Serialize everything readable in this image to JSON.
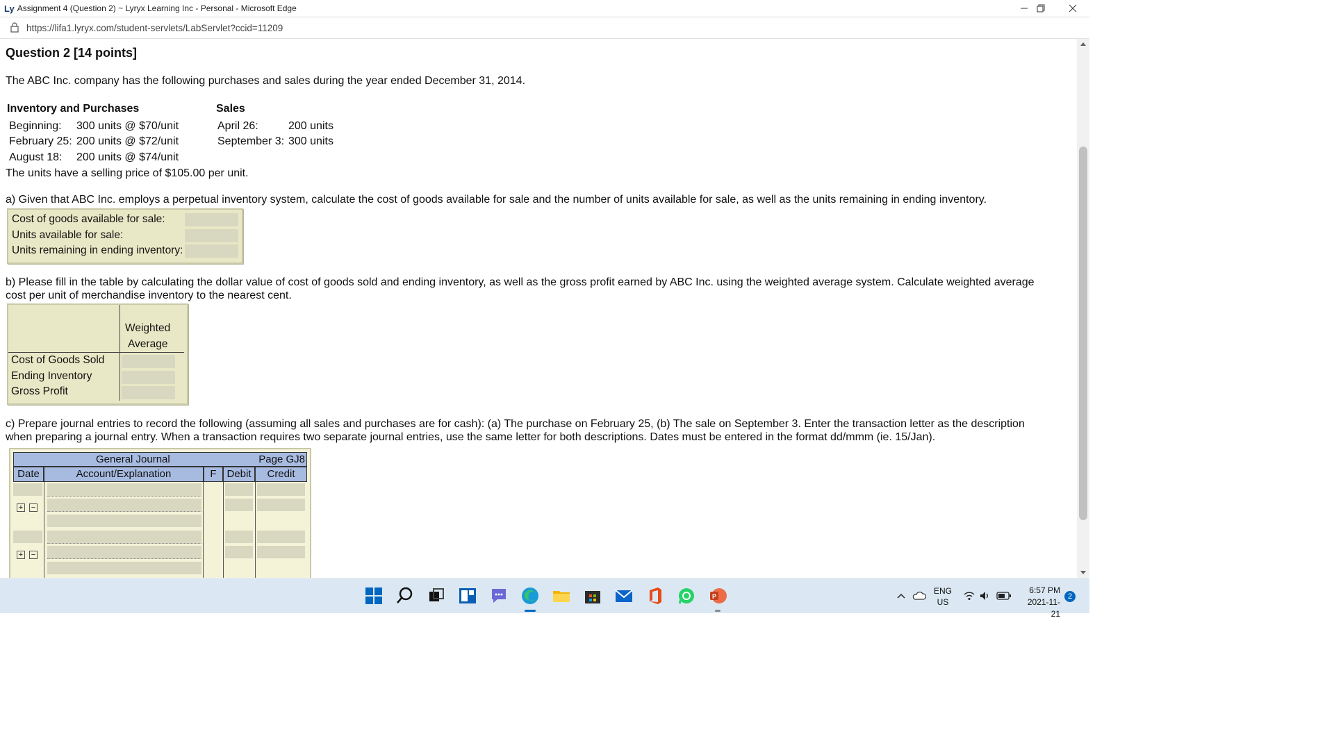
{
  "window": {
    "title": "Assignment 4 (Question 2) ~ Lyryx Learning Inc - Personal - Microsoft Edge",
    "logo": "Ly",
    "url": "https://lifa1.lyryx.com/student-servlets/LabServlet?ccid=11209"
  },
  "question": {
    "title": "Question 2 [14 points]",
    "intro": "The ABC Inc. company has the following purchases and sales during the year ended December 31, 2014.",
    "inventory_heading": "Inventory and Purchases",
    "sales_heading": "Sales",
    "inventory_rows": [
      {
        "label": "Beginning:",
        "value": "300 units @ $70/unit"
      },
      {
        "label": "February 25:",
        "value": "200 units @ $72/unit"
      },
      {
        "label": "August 18:",
        "value": "200 units @ $74/unit"
      }
    ],
    "sales_rows": [
      {
        "label": "April 26:",
        "value": "200 units"
      },
      {
        "label": "September 3:",
        "value": "300 units"
      }
    ],
    "selling_price": "The units have a selling price of $105.00 per unit."
  },
  "part_a": {
    "instruction": "a) Given that ABC Inc. employs a perpetual inventory system, calculate the cost of goods available for sale and the number of units available for sale, as well as the units remaining in ending inventory.",
    "rows": [
      "Cost of goods available for sale:",
      "Units available for sale:",
      "Units remaining in ending inventory:"
    ]
  },
  "part_b": {
    "instruction_line1": "b) Please fill in the table by calculating the dollar value of cost of goods sold and ending inventory, as well as the gross profit earned by ABC Inc. using the weighted average system. Calculate weighted average",
    "instruction_line2": "cost per unit of merchandise inventory to the nearest cent.",
    "col_header_1": "Weighted",
    "col_header_2": "Average",
    "rows": [
      "Cost of Goods Sold",
      "Ending Inventory",
      "Gross Profit"
    ]
  },
  "part_c": {
    "instruction_line1": "c) Prepare journal entries to record the following (assuming all sales and purchases are for cash): (a) The purchase on February 25, (b) The sale on September 3. Enter the transaction letter as the description",
    "instruction_line2": "when preparing a journal entry. When a transaction requires two separate journal entries, use the same letter for both descriptions. Dates must be entered in the format dd/mmm (ie. 15/Jan).",
    "journal_title": "General Journal",
    "page_label": "Page GJ8",
    "columns": {
      "date": "Date",
      "account": "Account/Explanation",
      "f": "F",
      "debit": "Debit",
      "credit": "Credit"
    },
    "plus": "+",
    "minus": "−"
  },
  "taskbar": {
    "lang_1": "ENG",
    "lang_2": "US",
    "time": "6:57 PM",
    "date": "2021-11-21",
    "notifications": "2"
  },
  "colors": {
    "panel": "#e9e8c6",
    "field": "#d8d7c0",
    "journal_header": "#a7bbe1",
    "taskbar": "#dbe8f3"
  }
}
